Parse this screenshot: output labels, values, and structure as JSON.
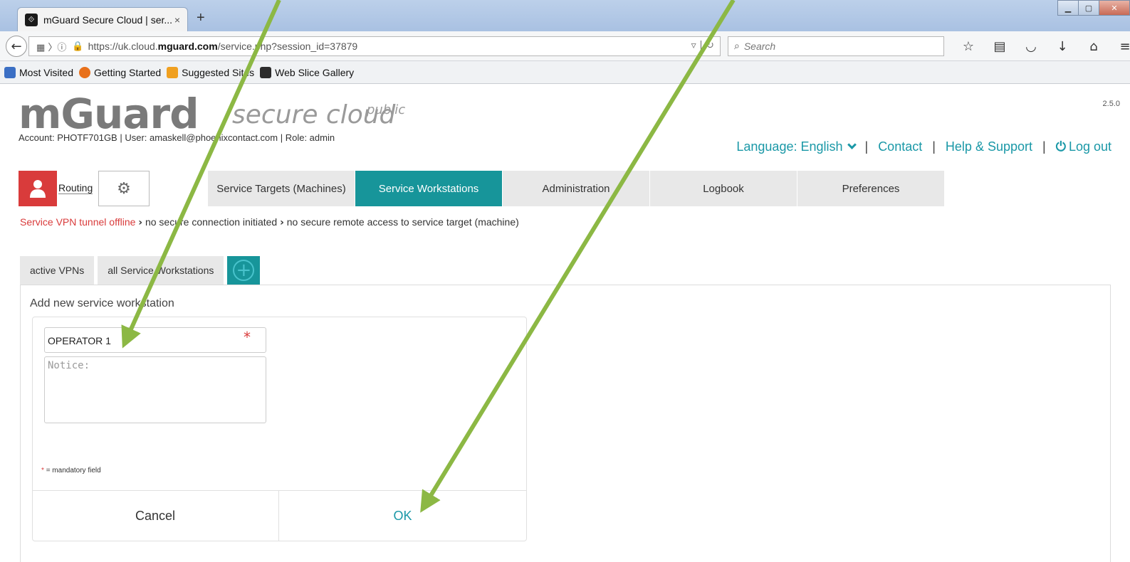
{
  "browser": {
    "tab_title": "mGuard Secure Cloud | ser...",
    "tab_close": "×",
    "new_tab": "+",
    "url_prefix": "https://uk.cloud.",
    "url_domain": "mguard.com",
    "url_suffix": "/service.php?session_id=37879",
    "search_placeholder": "Search",
    "bookmarks": [
      {
        "label": "Most Visited",
        "color": "#3b6fc4"
      },
      {
        "label": "Getting Started",
        "color": "#e8701a"
      },
      {
        "label": "Suggested Sites",
        "color": "#f0a020"
      },
      {
        "label": "Web Slice Gallery",
        "color": "#2c2c2c"
      }
    ]
  },
  "header": {
    "version": "2.5.0",
    "logo_main": "mGuard",
    "logo_sub": "secure cloud",
    "logo_sup": "public",
    "account_line": "Account: PHOTF701GB | User: amaskell@phoenixcontact.com | Role: admin",
    "language": "Language: English",
    "contact": "Contact",
    "help": "Help & Support",
    "logout": "Log out"
  },
  "toolbar": {
    "routing": "Routing"
  },
  "nav": {
    "tabs": [
      {
        "label": "Service Targets (Machines)",
        "active": false
      },
      {
        "label": "Service Workstations",
        "active": true
      },
      {
        "label": "Administration",
        "active": false
      },
      {
        "label": "Logbook",
        "active": false
      },
      {
        "label": "Preferences",
        "active": false
      }
    ]
  },
  "status": {
    "part1": "Service VPN tunnel offline",
    "part2": "no secure connection initiated",
    "part3": "no secure remote access to service target (machine)"
  },
  "subtabs": {
    "active_vpns": "active VPNs",
    "all_workstations": "all Service Workstations",
    "add_symbol": "+"
  },
  "form": {
    "title": "Add new service workstation",
    "name_value": "OPERATOR 1",
    "required_star": "*",
    "notice_placeholder": "Notice:",
    "mandatory_star": "*",
    "mandatory_text": "= mandatory field",
    "cancel": "Cancel",
    "ok": "OK"
  },
  "colors": {
    "accent": "#17959a",
    "link": "#1a98a7",
    "alert": "#d93b3b",
    "annotation_arrow": "#8cb844"
  }
}
